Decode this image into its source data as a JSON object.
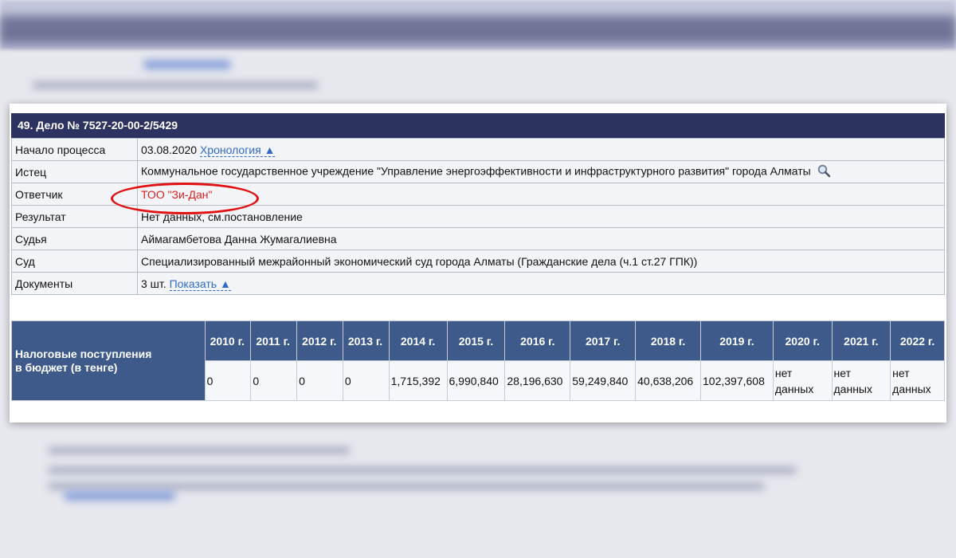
{
  "case": {
    "header": "49. Дело № 7527-20-00-2/5429",
    "rows": [
      {
        "label": "Начало процесса",
        "value": "03.08.2020",
        "link": "Хронология ▲"
      },
      {
        "label": "Истец",
        "value": "Коммунальное государственное учреждение \"Управление энергоэффективности и инфраструктурного развития\" города Алматы"
      },
      {
        "label": "Ответчик",
        "value": "ТОО \"Зи-Дан\""
      },
      {
        "label": "Результат",
        "value": "Нет данных, см.постановление"
      },
      {
        "label": "Судья",
        "value": "Аймагамбетова Данна Жумагалиевна"
      },
      {
        "label": "Суд",
        "value": "Специализированный межрайонный экономический суд города Алматы (Гражданские дела (ч.1 ст.27 ГПК))"
      },
      {
        "label": "Документы",
        "value": "3 шт.",
        "link": "Показать ▲"
      }
    ]
  },
  "tax": {
    "label_line1": "Налоговые поступления",
    "label_line2": "в бюджет (в тенге)",
    "years": [
      "2010 г.",
      "2011 г.",
      "2012 г.",
      "2013 г.",
      "2014 г.",
      "2015 г.",
      "2016 г.",
      "2017 г.",
      "2018 г.",
      "2019 г.",
      "2020 г.",
      "2021 г.",
      "2022 г."
    ],
    "values": [
      "0",
      "0",
      "0",
      "0",
      "1,715,392",
      "6,990,840",
      "28,196,630",
      "59,249,840",
      "40,638,206",
      "102,397,608",
      "нет данных",
      "нет данных",
      "нет данных"
    ]
  },
  "colors": {
    "header_bg": "#2d3361",
    "tax_header_bg": "#3e5a8a",
    "link": "#2f6bc7",
    "highlight": "#e01010"
  },
  "icons": {
    "search": "magnifier-icon"
  }
}
